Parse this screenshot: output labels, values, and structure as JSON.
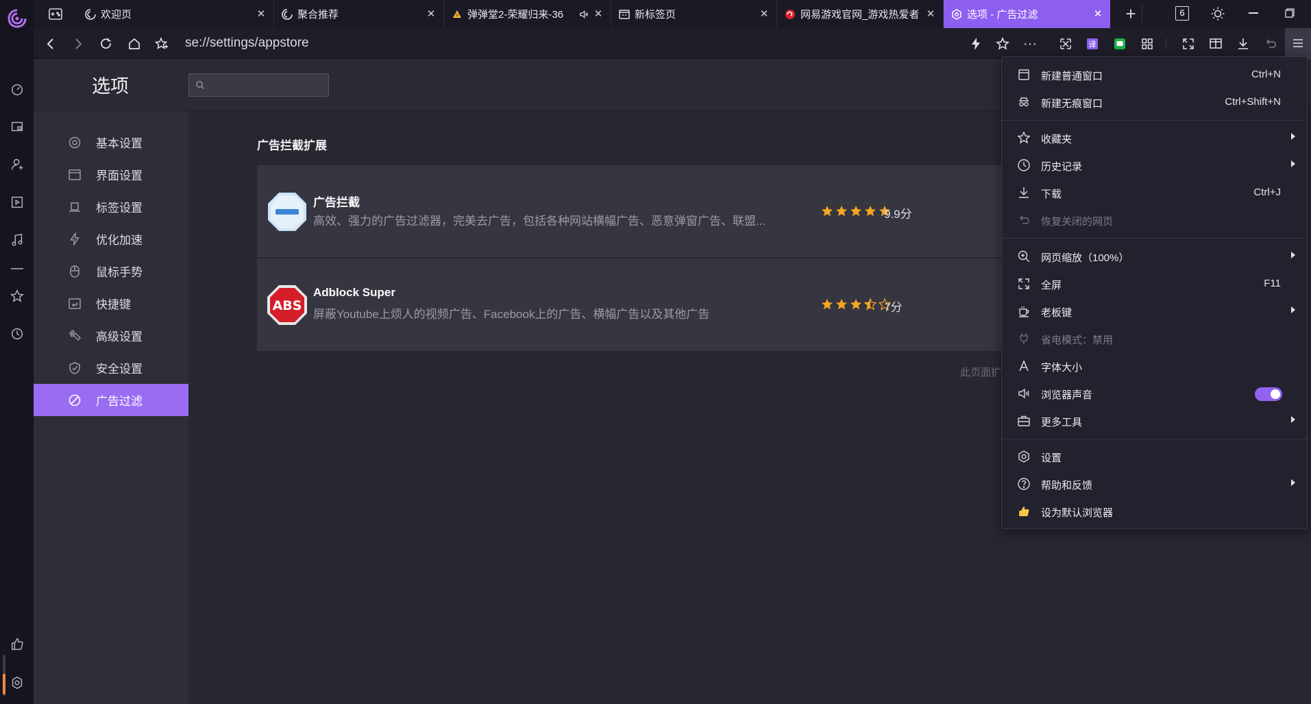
{
  "tabs": [
    {
      "label": "欢迎页",
      "icon": "swirl-logo-icon"
    },
    {
      "label": "聚合推荐",
      "icon": "swirl-logo-icon"
    },
    {
      "label": "弹弹堂2-荣耀归来-36",
      "icon": "game-icon",
      "audio": true
    },
    {
      "label": "新标签页",
      "icon": "new-tab-icon"
    },
    {
      "label": "网易游戏官网_游戏热爱者",
      "icon": "netease-icon"
    },
    {
      "label": "选项 - 广告过滤",
      "icon": "gear-icon",
      "active": true
    }
  ],
  "tab_counter": "6",
  "address": {
    "url": "se://settings/appstore"
  },
  "settings": {
    "title": "选项",
    "search_placeholder": "",
    "nav": [
      {
        "label": "基本设置",
        "icon": "basic-settings-icon"
      },
      {
        "label": "界面设置",
        "icon": "interface-icon"
      },
      {
        "label": "标签设置",
        "icon": "tab-settings-icon"
      },
      {
        "label": "优化加速",
        "icon": "lightning-icon"
      },
      {
        "label": "鼠标手势",
        "icon": "mouse-icon"
      },
      {
        "label": "快捷键",
        "icon": "shortcut-icon"
      },
      {
        "label": "高级设置",
        "icon": "wrench-icon"
      },
      {
        "label": "安全设置",
        "icon": "shield-icon"
      },
      {
        "label": "广告过滤",
        "icon": "block-icon",
        "active": true
      }
    ]
  },
  "main": {
    "section_title": "广告拦截扩展",
    "extensions": [
      {
        "name": "广告拦截",
        "description": "高效、强力的广告过滤器，完美去广告，包括各种网站横幅广告、恶意弹窗广告、联盟...",
        "rating": 5,
        "score": "9.9分"
      },
      {
        "name": "Adblock Super",
        "description": "屏蔽Youtube上烦人的视频广告、Facebook上的广告、横幅广告以及其他广告",
        "rating": 3.5,
        "score": "7分"
      }
    ],
    "footnote": "此页面扩"
  },
  "menu": {
    "items": [
      {
        "label": "新建普通窗口",
        "shortcut": "Ctrl+N",
        "icon": "window-icon"
      },
      {
        "label": "新建无痕窗口",
        "shortcut": "Ctrl+Shift+N",
        "icon": "incognito-icon"
      },
      {
        "label": "收藏夹",
        "icon": "star-icon",
        "submenu": true
      },
      {
        "label": "历史记录",
        "icon": "clock-icon",
        "submenu": true
      },
      {
        "label": "下载",
        "shortcut": "Ctrl+J",
        "icon": "download-icon"
      },
      {
        "label": "恢复关闭的网页",
        "icon": "undo-icon",
        "disabled": true
      },
      {
        "label": "网页缩放（100%）",
        "icon": "zoom-icon",
        "submenu": true
      },
      {
        "label": "全屏",
        "shortcut": "F11",
        "icon": "fullscreen-icon"
      },
      {
        "label": "老板键",
        "icon": "boss-key-icon",
        "submenu": true
      },
      {
        "label": "省电模式：禁用",
        "icon": "plug-icon",
        "disabled": true
      },
      {
        "label": "字体大小",
        "icon": "font-size-icon"
      },
      {
        "label": "浏览器声音",
        "icon": "speaker-icon",
        "toggle": true
      },
      {
        "label": "更多工具",
        "icon": "toolbox-icon",
        "submenu": true
      },
      {
        "label": "设置",
        "icon": "gear-icon"
      },
      {
        "label": "帮助和反馈",
        "icon": "help-icon",
        "submenu": true
      },
      {
        "label": "设为默认浏览器",
        "icon": "thumbs-up-icon"
      }
    ]
  },
  "colors": {
    "accent": "#9a6cf2",
    "star": "#f5a623",
    "sidebar_bg": "#16151f"
  }
}
